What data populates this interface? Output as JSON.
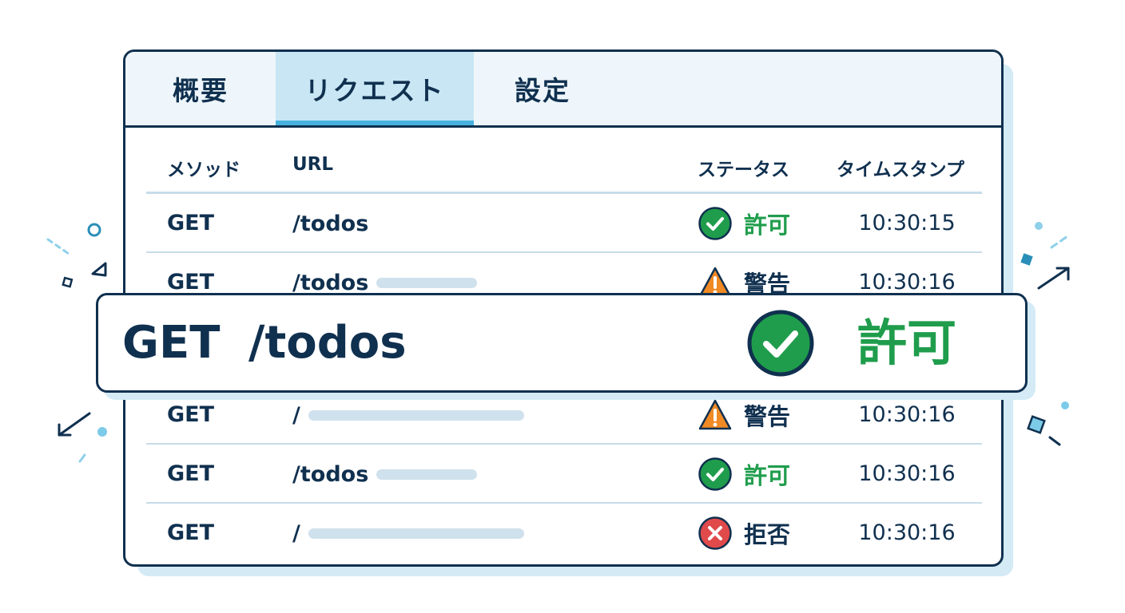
{
  "tabs": [
    {
      "label": "概要",
      "active": false
    },
    {
      "label": "リクエスト",
      "active": true
    },
    {
      "label": "設定",
      "active": false
    }
  ],
  "columns": {
    "method": "メソッド",
    "url": "URL",
    "status": "ステータス",
    "timestamp": "タイムスタンプ"
  },
  "rows": [
    {
      "method": "GET",
      "url": "/todos",
      "url_truncated": false,
      "status": "許可",
      "status_kind": "allow",
      "time": "10:30:15"
    },
    {
      "method": "GET",
      "url": "/todos",
      "url_truncated": true,
      "status": "警告",
      "status_kind": "warn",
      "time": "10:30:16"
    },
    {
      "method": "GET",
      "url": "/",
      "url_truncated": true,
      "status": "警告",
      "status_kind": "warn",
      "time": "10:30:16"
    },
    {
      "method": "GET",
      "url": "/todos",
      "url_truncated": true,
      "status": "許可",
      "status_kind": "allow",
      "time": "10:30:16"
    },
    {
      "method": "GET",
      "url": "/",
      "url_truncated": true,
      "status": "拒否",
      "status_kind": "deny",
      "time": "10:30:16"
    }
  ],
  "highlight": {
    "method": "GET",
    "url": "/todos",
    "status": "許可",
    "status_kind": "allow"
  },
  "status_icons": {
    "allow": "check-circle-icon",
    "warn": "warning-triangle-icon",
    "deny": "x-circle-icon"
  },
  "colors": {
    "allow": "#1f9d4c",
    "warn": "#f08a24",
    "deny": "#e14a4a",
    "text": "#10304f",
    "accent": "#46b1de"
  }
}
